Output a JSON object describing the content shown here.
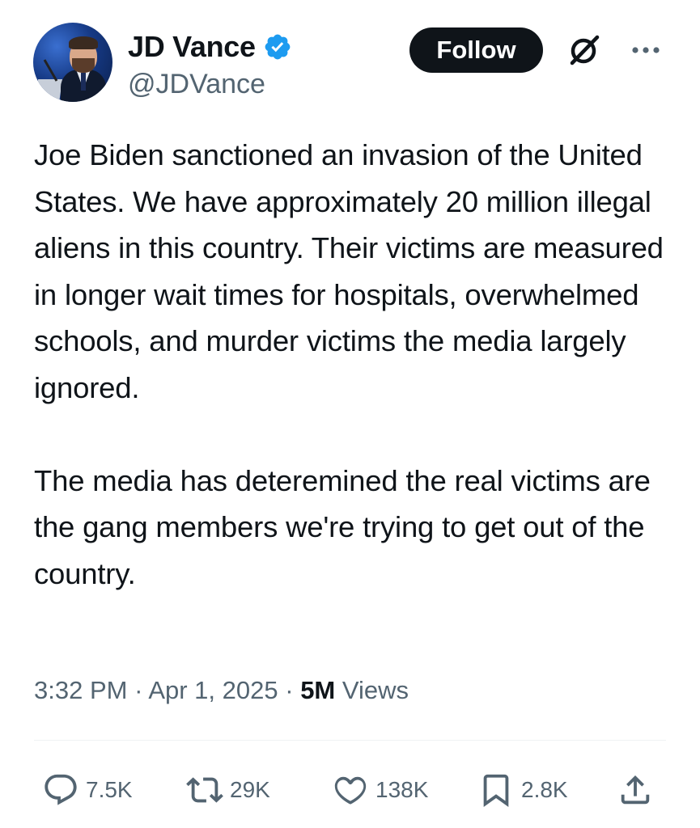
{
  "author": {
    "name": "JD Vance",
    "handle": "@JDVance",
    "verified_color": "#1d9bf0"
  },
  "follow_button": {
    "label": "Follow"
  },
  "icons": {
    "verified": "verified-badge-icon",
    "grok": "grok-icon",
    "more": "more-options-icon",
    "reply": "reply-icon",
    "repost": "repost-icon",
    "like": "like-icon",
    "bookmark": "bookmark-icon",
    "share": "share-icon"
  },
  "tweet": {
    "paragraphs": [
      "Joe Biden sanctioned an invasion of the United States. We have approximately 20 million illegal aliens in this country. Their victims are measured in longer wait times for hospitals, overwhelmed schools, and murder victims the media largely ignored.",
      "The media has deteremined the real victims are the gang members we're trying to get out of the country."
    ]
  },
  "meta": {
    "time": "3:32 PM",
    "separator": "·",
    "date": "Apr 1, 2025",
    "views_count": "5M",
    "views_label": "Views"
  },
  "actions": {
    "replies": "7.5K",
    "reposts": "29K",
    "likes": "138K",
    "bookmarks": "2.8K"
  }
}
